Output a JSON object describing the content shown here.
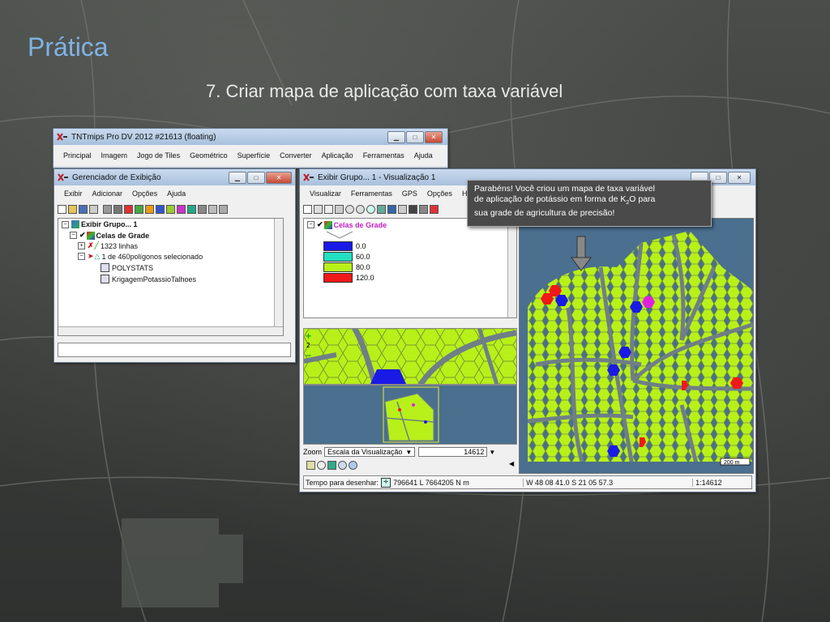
{
  "slide": {
    "title": "Prática",
    "subtitle": "7. Criar mapa de aplicação com taxa variável"
  },
  "main_window": {
    "title": "TNTmips Pro DV 2012  #21613 (floating)",
    "menu": [
      "Principal",
      "Imagem",
      "Jogo de Tiles",
      "Geométrico",
      "Superfície",
      "Converter",
      "Aplicação",
      "Ferramentas",
      "Ajuda"
    ]
  },
  "display_manager": {
    "title": "Gerenciador de Exibição",
    "menu": [
      "Exibir",
      "Adicionar",
      "Opções",
      "Ajuda"
    ],
    "tree": {
      "group": "Exibir Grupo... 1",
      "layer": "Celas de Grade",
      "lines": "1323 linhas",
      "polygons": "1 de 460polígonos selecionado",
      "table1": "POLYSTATS",
      "table2": "KrigagemPotassioTalhoes"
    }
  },
  "view_window": {
    "title": "Exibir Grupo... 1 - Visualização 1",
    "menu": [
      "Visualizar",
      "Ferramentas",
      "GPS",
      "Opções",
      "H"
    ],
    "legend": {
      "layer": "Celas de Grade",
      "items": [
        {
          "label": "0.0",
          "color": "#1a1ae6"
        },
        {
          "label": "60.0",
          "color": "#22e0c0"
        },
        {
          "label": "80.0",
          "color": "#b8f01a"
        },
        {
          "label": "120.0",
          "color": "#f01818"
        }
      ]
    },
    "zoom_label": "Zoom",
    "zoom_mode": "Escala da Visualização",
    "zoom_value": "14612",
    "scale_bar": "200 m",
    "status": {
      "draw_time_label": "Tempo para desenhar:",
      "coords": "796641 L  7664205 N m",
      "geo": "W 48 08 41.0  S 21 05 57.3",
      "scale": "1:14612"
    },
    "zoom_side_label": "2"
  },
  "tooltip": {
    "line1": "Parabéns! Você criou um mapa de taxa variável",
    "line2_pre": "de aplicação de potássio em forma de K",
    "line2_sub": "2",
    "line2_post": "O para",
    "line3": "sua grade de agricultura de precisão!"
  },
  "colors": {
    "field_green": "#b8f01a",
    "road_gray": "#6f7f86",
    "map_bg": "#4a6f8f",
    "title_blue": "#7fb3e6"
  }
}
